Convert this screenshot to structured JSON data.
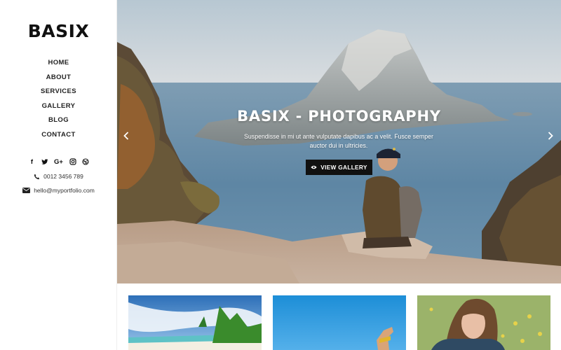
{
  "brand": {
    "logo": "BASIX"
  },
  "nav": [
    {
      "label": "HOME",
      "active": true
    },
    {
      "label": "ABOUT"
    },
    {
      "label": "SERVICES"
    },
    {
      "label": "GALLERY"
    },
    {
      "label": "BLOG"
    },
    {
      "label": "CONTACT"
    }
  ],
  "social": [
    {
      "icon": "facebook-icon",
      "glyph": "f"
    },
    {
      "icon": "twitter-icon",
      "glyph": "🐦"
    },
    {
      "icon": "google-plus-icon",
      "glyph": "G+"
    },
    {
      "icon": "instagram-icon",
      "glyph": "◎"
    },
    {
      "icon": "dribbble-icon",
      "glyph": "⊕"
    }
  ],
  "contact": {
    "phone_icon": "phone-icon",
    "phone": "0012 3456 789",
    "email_icon": "envelope-icon",
    "email": "hello@myportfolio.com"
  },
  "hero": {
    "title": "BASIX - PHOTOGRAPHY",
    "subtitle_line1": "Suspendisse in mi ut ante vulputate dapibus ac a velit. Fusce semper",
    "subtitle_line2": "auctor dui in ultricies.",
    "button_icon": "eye-icon",
    "button_label": "VIEW GALLERY",
    "prev_icon": "chevron-left-icon",
    "next_icon": "chevron-right-icon"
  },
  "gallery": [
    {
      "name": "gallery-thumb-beach"
    },
    {
      "name": "gallery-thumb-sky-hand"
    },
    {
      "name": "gallery-thumb-woman-portrait"
    }
  ],
  "colors": {
    "accent": "#111111",
    "sea": "#5d86a3",
    "sky": "#c9d5dd"
  }
}
